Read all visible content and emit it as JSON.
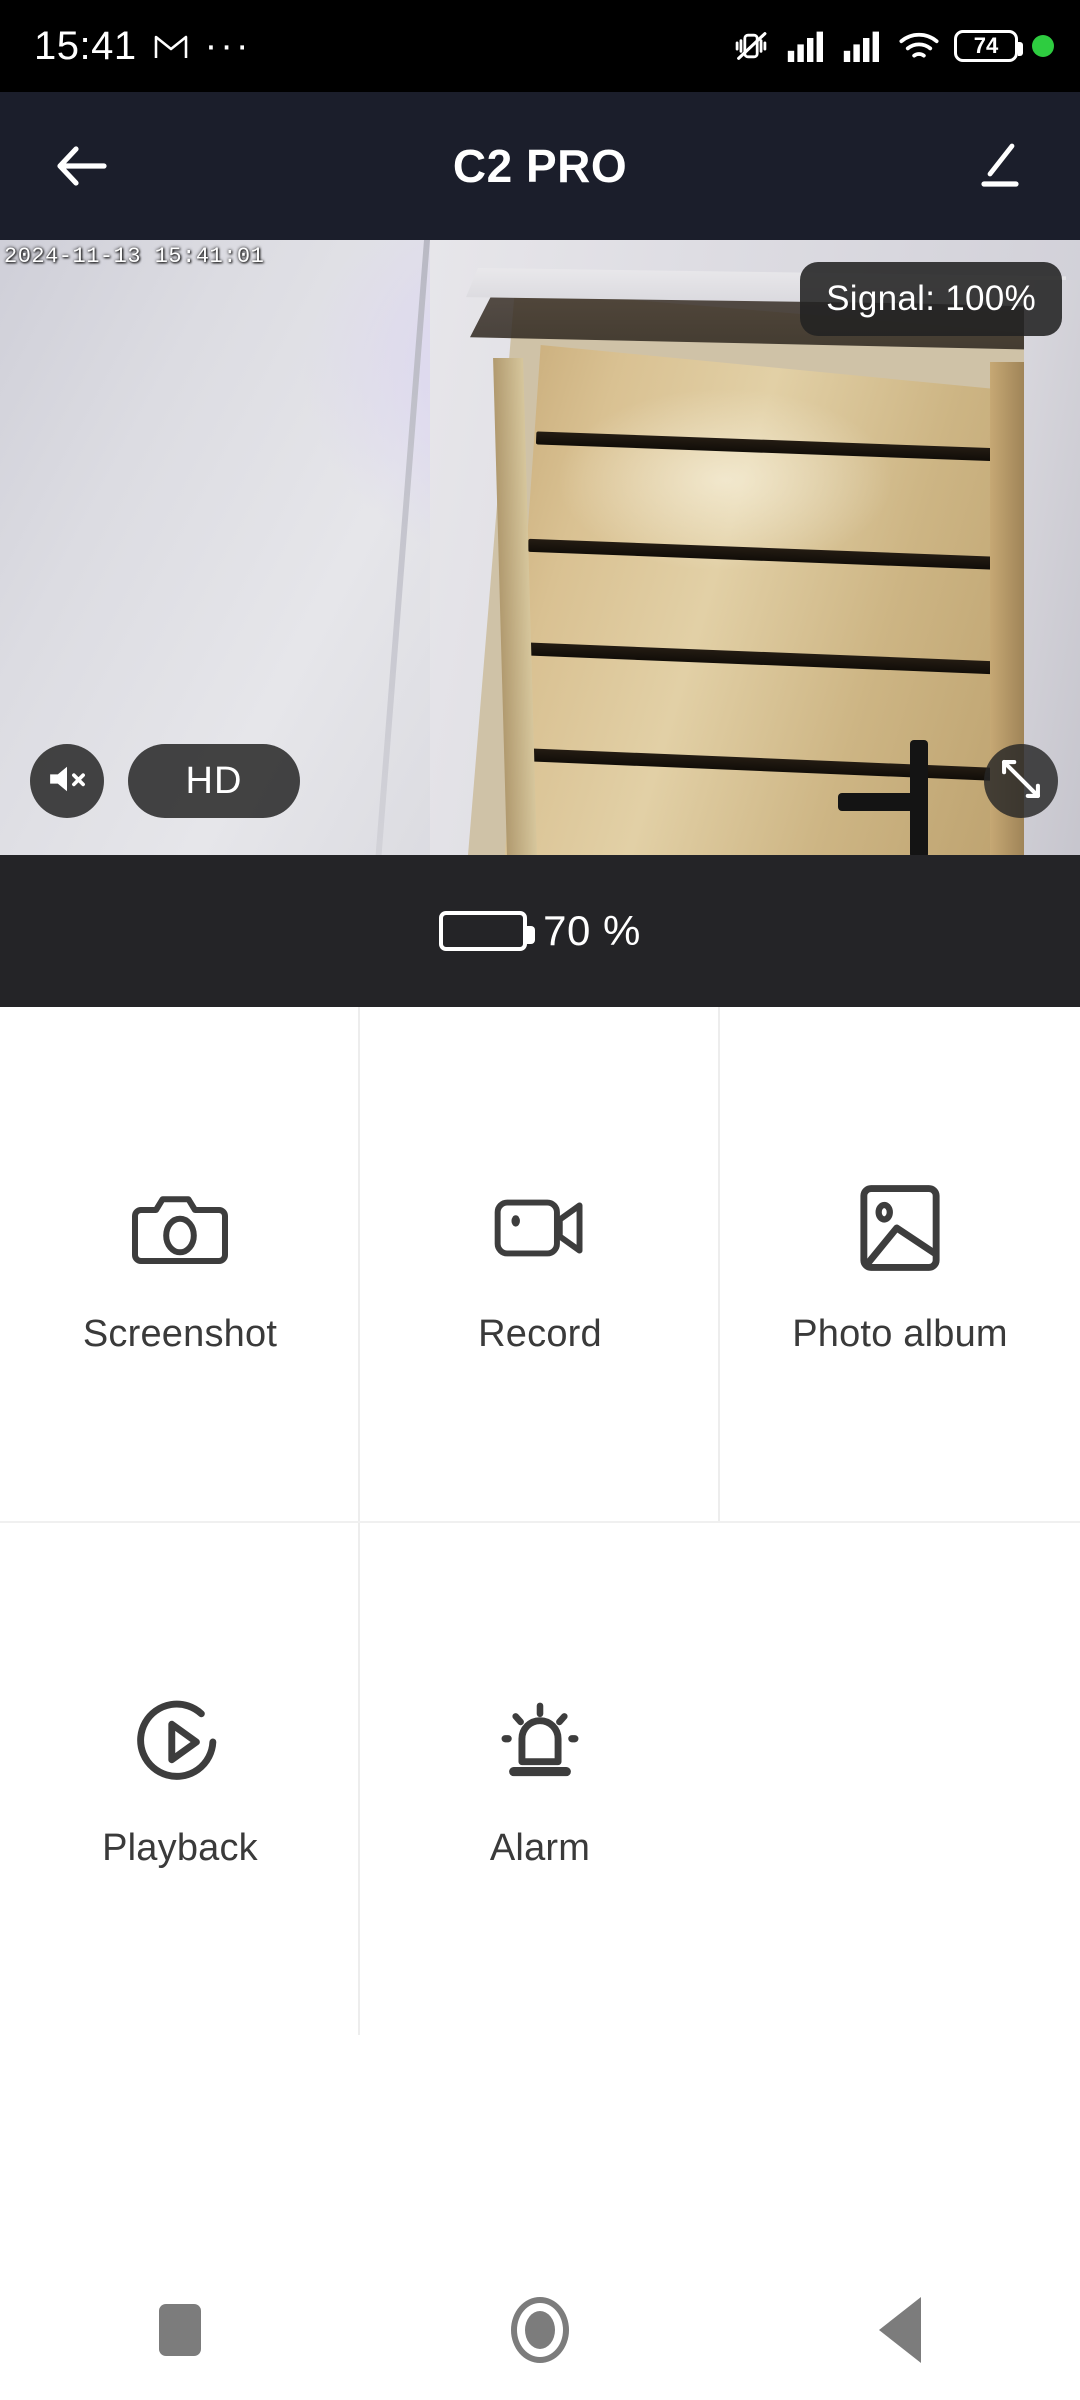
{
  "status_bar": {
    "time": "15:41",
    "gmail_icon": "gmail-icon",
    "overflow_icon": "more-dots-icon",
    "mute_icon": "vibrate-off-icon",
    "signal1_icon": "cell-signal-icon",
    "signal2_icon": "cell-signal-icon",
    "wifi_icon": "wifi-icon",
    "battery_level": "74",
    "recording_dot": "green-status-dot",
    "colors": {
      "background": "#000000",
      "battery_dot": "#2ecc40"
    }
  },
  "app_bar": {
    "back_icon": "arrow-left-icon",
    "title": "C2 PRO",
    "edit_icon": "pencil-edit-icon",
    "background": "#1b1e2b"
  },
  "video": {
    "timestamp": "2024-11-13 15:41:01",
    "signal_badge": "Signal: 100%",
    "mute_icon": "speaker-muted-icon",
    "quality_label": "HD",
    "fullscreen_icon": "fullscreen-expand-icon"
  },
  "battery_strip": {
    "icon": "battery-icon",
    "level_text": "70 %",
    "fill_percent": 70,
    "fill_color": "#2fd044",
    "background": "#242427"
  },
  "actions": [
    {
      "icon": "camera-icon",
      "label": "Screenshot"
    },
    {
      "icon": "video-camera-icon",
      "label": "Record"
    },
    {
      "icon": "photo-image-icon",
      "label": "Photo album"
    },
    {
      "icon": "playback-play-icon",
      "label": "Playback"
    },
    {
      "icon": "alarm-siren-icon",
      "label": "Alarm"
    },
    {
      "icon": "",
      "label": ""
    }
  ],
  "nav_bar": {
    "recents_icon": "square-recents-icon",
    "home_icon": "circle-home-icon",
    "back_icon": "triangle-back-icon"
  }
}
